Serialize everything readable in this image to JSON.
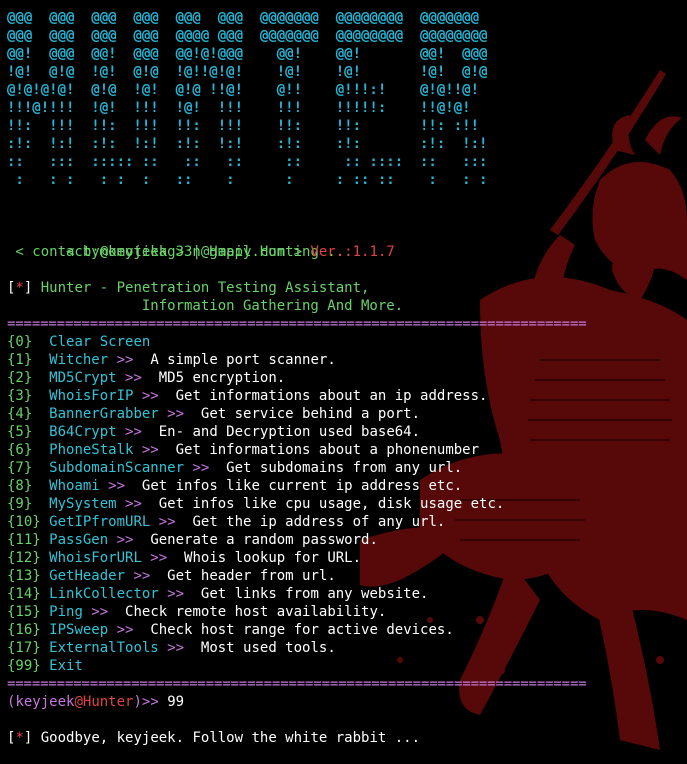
{
  "banner": [
    "@@@  @@@  @@@  @@@  @@@  @@@  @@@@@@@  @@@@@@@@  @@@@@@@",
    "@@@  @@@  @@@  @@@  @@@@ @@@  @@@@@@@  @@@@@@@@  @@@@@@@@",
    "@@!  @@@  @@!  @@@  @@!@!@@@    @@!    @@!       @@!  @@@",
    "!@!  @!@  !@!  @!@  !@!!@!@!    !@!    !@!       !@!  @!@",
    "@!@!@!@!  @!@  !@!  @!@ !!@!    @!!    @!!!:!    @!@!!@!",
    "!!!@!!!!  !@!  !!!  !@!  !!!    !!!    !!!!!:    !!@!@!",
    "!!:  !!!  !!:  !!!  !!:  !!!    !!:    !!:       !!: :!!",
    ":!:  !:!  :!:  !:!  :!:  !:!    :!:    :!:       :!:  !:!",
    "::   :::  ::::: ::   ::   ::     ::     :: ::::  ::   :::",
    " :   : :   : :  :   ::    :      :     : :: ::    :   : :"
  ],
  "credits": {
    "line1_prefix": " < by@keyjeek > | Happy Hunting ...",
    "line2_contact": " < contact:nomotikag33n@gmail.com > ",
    "line2_ver_label": "Ver.:",
    "line2_ver_value": "1.1.7"
  },
  "header": {
    "bracket_open": "[",
    "star": "*",
    "bracket_close": "]",
    "title": " Hunter - Penetration Testing Assistant,",
    "subtitle": "                Information Gathering And More."
  },
  "separator": "======================================================================",
  "menu": [
    {
      "num": "{0}",
      "pad": "  ",
      "name": "Clear Screen",
      "arrow": "",
      "desc": ""
    },
    {
      "num": "{1}",
      "pad": "  ",
      "name": "Witcher",
      "arrow": " >>",
      "desc": "  A simple port scanner."
    },
    {
      "num": "{2}",
      "pad": "  ",
      "name": "MD5Crypt",
      "arrow": " >>",
      "desc": "  MD5 encryption."
    },
    {
      "num": "{3}",
      "pad": "  ",
      "name": "WhoisForIP",
      "arrow": " >>",
      "desc": "  Get informations about an ip address."
    },
    {
      "num": "{4}",
      "pad": "  ",
      "name": "BannerGrabber",
      "arrow": " >>",
      "desc": "  Get service behind a port."
    },
    {
      "num": "{5}",
      "pad": "  ",
      "name": "B64Crypt",
      "arrow": " >>",
      "desc": "  En- and Decryption used base64."
    },
    {
      "num": "{6}",
      "pad": "  ",
      "name": "PhoneStalk",
      "arrow": " >>",
      "desc": "  Get informations about a phonenumber"
    },
    {
      "num": "{7}",
      "pad": "  ",
      "name": "SubdomainScanner",
      "arrow": " >>",
      "desc": "  Get subdomains from any url."
    },
    {
      "num": "{8}",
      "pad": "  ",
      "name": "Whoami",
      "arrow": " >>",
      "desc": "  Get infos like current ip address etc."
    },
    {
      "num": "{9}",
      "pad": "  ",
      "name": "MySystem",
      "arrow": " >>",
      "desc": "  Get infos like cpu usage, disk usage etc."
    },
    {
      "num": "{10}",
      "pad": " ",
      "name": "GetIPfromURL",
      "arrow": " >>",
      "desc": "  Get the ip address of any url."
    },
    {
      "num": "{11}",
      "pad": " ",
      "name": "PassGen",
      "arrow": " >>",
      "desc": "  Generate a random password."
    },
    {
      "num": "{12}",
      "pad": " ",
      "name": "WhoisForURL",
      "arrow": " >>",
      "desc": "  Whois lookup for URL."
    },
    {
      "num": "{13}",
      "pad": " ",
      "name": "GetHeader",
      "arrow": " >>",
      "desc": "  Get header from url."
    },
    {
      "num": "{14}",
      "pad": " ",
      "name": "LinkCollector",
      "arrow": " >>",
      "desc": "  Get links from any website."
    },
    {
      "num": "{15}",
      "pad": " ",
      "name": "Ping",
      "arrow": " >>",
      "desc": "  Check remote host availability."
    },
    {
      "num": "{16}",
      "pad": " ",
      "name": "IPSweep",
      "arrow": " >>",
      "desc": "  Check host range for active devices."
    },
    {
      "num": "{17}",
      "pad": " ",
      "name": "ExternalTools",
      "arrow": " >>",
      "desc": "  Most used tools."
    },
    {
      "num": "{99}",
      "pad": " ",
      "name": "Exit",
      "arrow": "",
      "desc": ""
    }
  ],
  "prompt": {
    "open": "(",
    "user": "keyjeek",
    "at": "@",
    "host": "Hunter",
    "close": ")>>",
    "input": " 99"
  },
  "goodbye": {
    "bracket_open": "[",
    "star": "*",
    "bracket_close": "]",
    "message": " Goodbye, keyjeek. Follow the white rabbit ..."
  },
  "colors": {
    "banner": "#27b5d6",
    "green": "#6ad26a",
    "cyan": "#33c3d6",
    "magenta": "#c678dd",
    "red": "#e04343",
    "background": "#000000",
    "art": "#5c0a0a"
  },
  "icons": {
    "background_art": "samurai-silhouette-icon"
  }
}
